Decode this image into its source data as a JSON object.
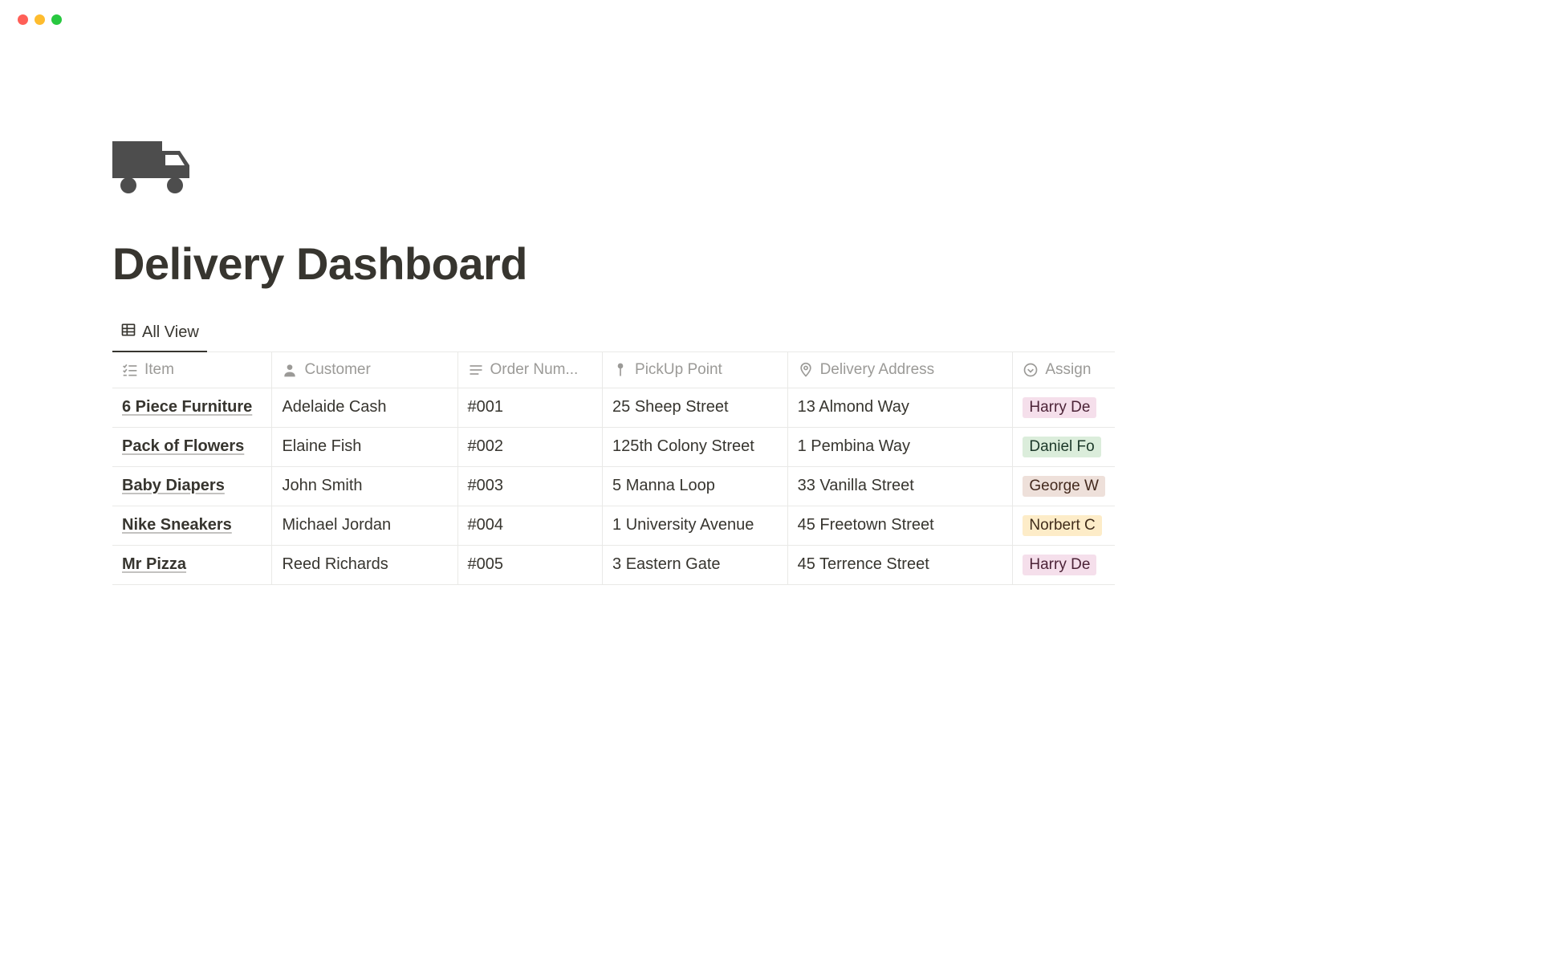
{
  "page": {
    "title": "Delivery Dashboard"
  },
  "view": {
    "active_tab_label": "All View"
  },
  "columns": {
    "item": "Item",
    "customer": "Customer",
    "order_number": "Order Num...",
    "pickup": "PickUp Point",
    "delivery": "Delivery Address",
    "assign": "Assign"
  },
  "rows": [
    {
      "item": "6 Piece Furniture",
      "customer": "Adelaide Cash",
      "order_number": "#001",
      "pickup": "25 Sheep Street",
      "delivery": "13 Almond Way",
      "assign_label": "Harry De",
      "assign_color": "pink"
    },
    {
      "item": "Pack of Flowers",
      "customer": "Elaine Fish",
      "order_number": "#002",
      "pickup": "125th Colony Street",
      "delivery": "1 Pembina Way",
      "assign_label": "Daniel Fo",
      "assign_color": "green"
    },
    {
      "item": "Baby Diapers",
      "customer": "John Smith",
      "order_number": "#003",
      "pickup": "5 Manna Loop",
      "delivery": "33 Vanilla Street",
      "assign_label": "George W",
      "assign_color": "brown"
    },
    {
      "item": "Nike Sneakers",
      "customer": "Michael Jordan",
      "order_number": "#004",
      "pickup": "1 University Avenue",
      "delivery": "45 Freetown Street",
      "assign_label": "Norbert C",
      "assign_color": "yellow"
    },
    {
      "item": "Mr Pizza",
      "customer": "Reed Richards",
      "order_number": "#005",
      "pickup": "3 Eastern Gate",
      "delivery": "45 Terrence Street",
      "assign_label": "Harry De",
      "assign_color": "pink"
    }
  ]
}
